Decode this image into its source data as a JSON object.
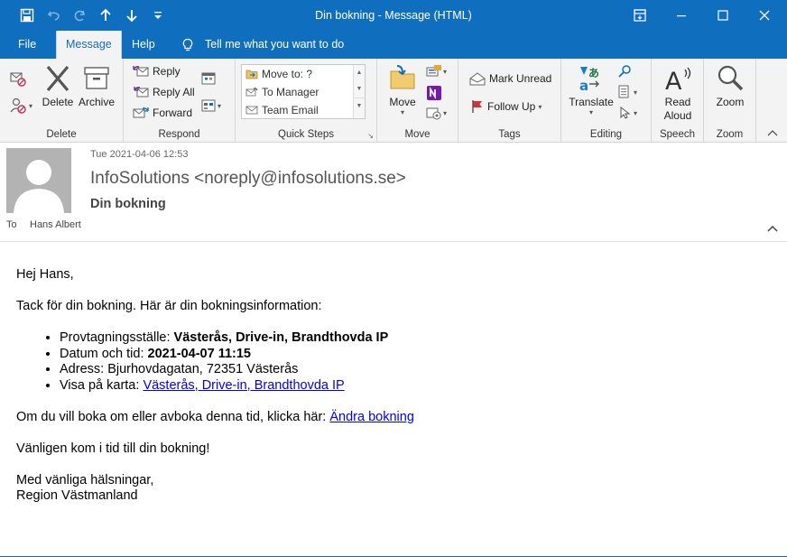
{
  "window": {
    "title": "Din bokning  -  Message (HTML)",
    "controls": [
      "restore-ribbon",
      "minimize",
      "maximize",
      "close"
    ]
  },
  "ribbon_tabs": [
    {
      "label": "File"
    },
    {
      "label": "Message",
      "active": true
    },
    {
      "label": "Help"
    },
    {
      "label": "Tell me what you want to do"
    }
  ],
  "ribbon": {
    "delete": {
      "label": "Delete",
      "delete_btn": "Delete",
      "archive_btn": "Archive"
    },
    "respond": {
      "label": "Respond",
      "reply": "Reply",
      "reply_all": "Reply All",
      "forward": "Forward"
    },
    "quick_steps": {
      "label": "Quick Steps",
      "items": [
        "Move to: ?",
        "To Manager",
        "Team Email"
      ]
    },
    "move": {
      "label": "Move",
      "move_btn": "Move"
    },
    "tags": {
      "label": "Tags",
      "mark_unread": "Mark Unread",
      "follow_up": "Follow Up"
    },
    "editing": {
      "label": "Editing",
      "translate": "Translate"
    },
    "speech": {
      "label": "Speech",
      "read_aloud_line1": "Read",
      "read_aloud_line2": "Aloud"
    },
    "zoom": {
      "label": "Zoom",
      "zoom_btn": "Zoom"
    }
  },
  "message": {
    "date": "Tue 2021-04-06 12:53",
    "from": "InfoSolutions <noreply@infosolutions.se>",
    "subject": "Din bokning",
    "to_label": "To",
    "to_name": "Hans Albert"
  },
  "body": {
    "greeting": "Hej Hans,",
    "intro": "Tack för din bokning. Här är din bokningsinformation:",
    "list": [
      {
        "label": "Provtagningsställe: ",
        "value": "Västerås, Drive-in, Brandthovda IP"
      },
      {
        "label": "Datum och tid: ",
        "value": "2021-04-07 11:15"
      },
      {
        "label": "Adress: ",
        "value": "Bjurhovdagatan, 72351 Västerås"
      },
      {
        "label": "Visa på karta: ",
        "link": "Västerås, Drive-in, Brandthovda IP"
      }
    ],
    "change_text": "Om du vill boka om eller avboka denna tid, klicka här: ",
    "change_link": "Ändra bokning",
    "reminder": "Vänligen kom i tid till din bokning!",
    "closing": "Med vänliga hälsningar,",
    "signature": "Region Västmanland"
  },
  "colors": {
    "accent": "#106ebe",
    "link": "#0000ee",
    "ribbon_bg": "#f3f3f3"
  }
}
